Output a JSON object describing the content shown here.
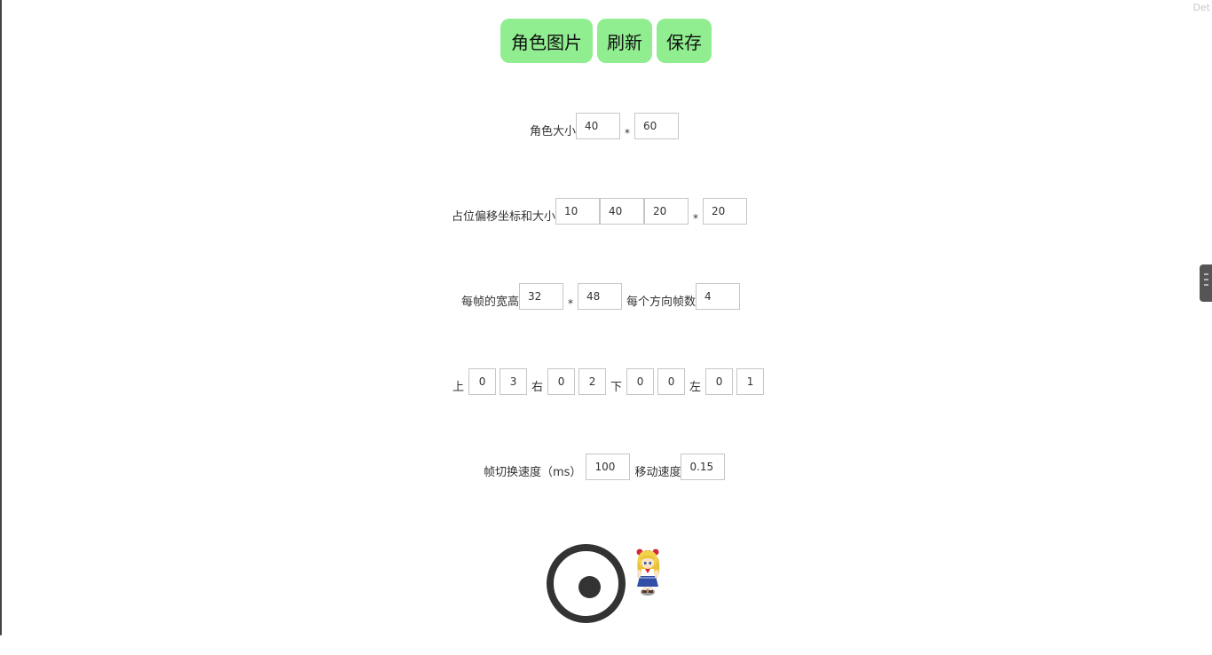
{
  "corner_text": "Det",
  "toolbar": {
    "character_image_label": "角色图片",
    "refresh_label": "刷新",
    "save_label": "保存"
  },
  "character_size": {
    "label": "角色大小",
    "separator": "*",
    "width": "40",
    "height": "60"
  },
  "placeholder_offset": {
    "label": "占位偏移坐标和大小",
    "x": "10",
    "y": "40",
    "width": "20",
    "separator": "*",
    "height": "20"
  },
  "frame": {
    "label": "每帧的宽高",
    "width": "32",
    "separator": "*",
    "height": "48",
    "frames_per_direction_label": "每个方向帧数",
    "frames_per_direction": "4"
  },
  "directions": {
    "up_label": "上",
    "up_values": [
      "0",
      "3"
    ],
    "right_label": "右",
    "right_values": [
      "0",
      "2"
    ],
    "down_label": "下",
    "down_values": [
      "0",
      "0"
    ],
    "left_label": "左",
    "left_values": [
      "0",
      "1"
    ]
  },
  "speed": {
    "frame_switch_label": "帧切换速度（ms）",
    "frame_switch_value": "100",
    "move_label": "移动速度",
    "move_value": "0.15"
  },
  "icons": {
    "joystick": "joystick-icon",
    "character": "character-sprite"
  },
  "colors": {
    "button_bg": "#90ee90",
    "joystick": "#333333"
  }
}
